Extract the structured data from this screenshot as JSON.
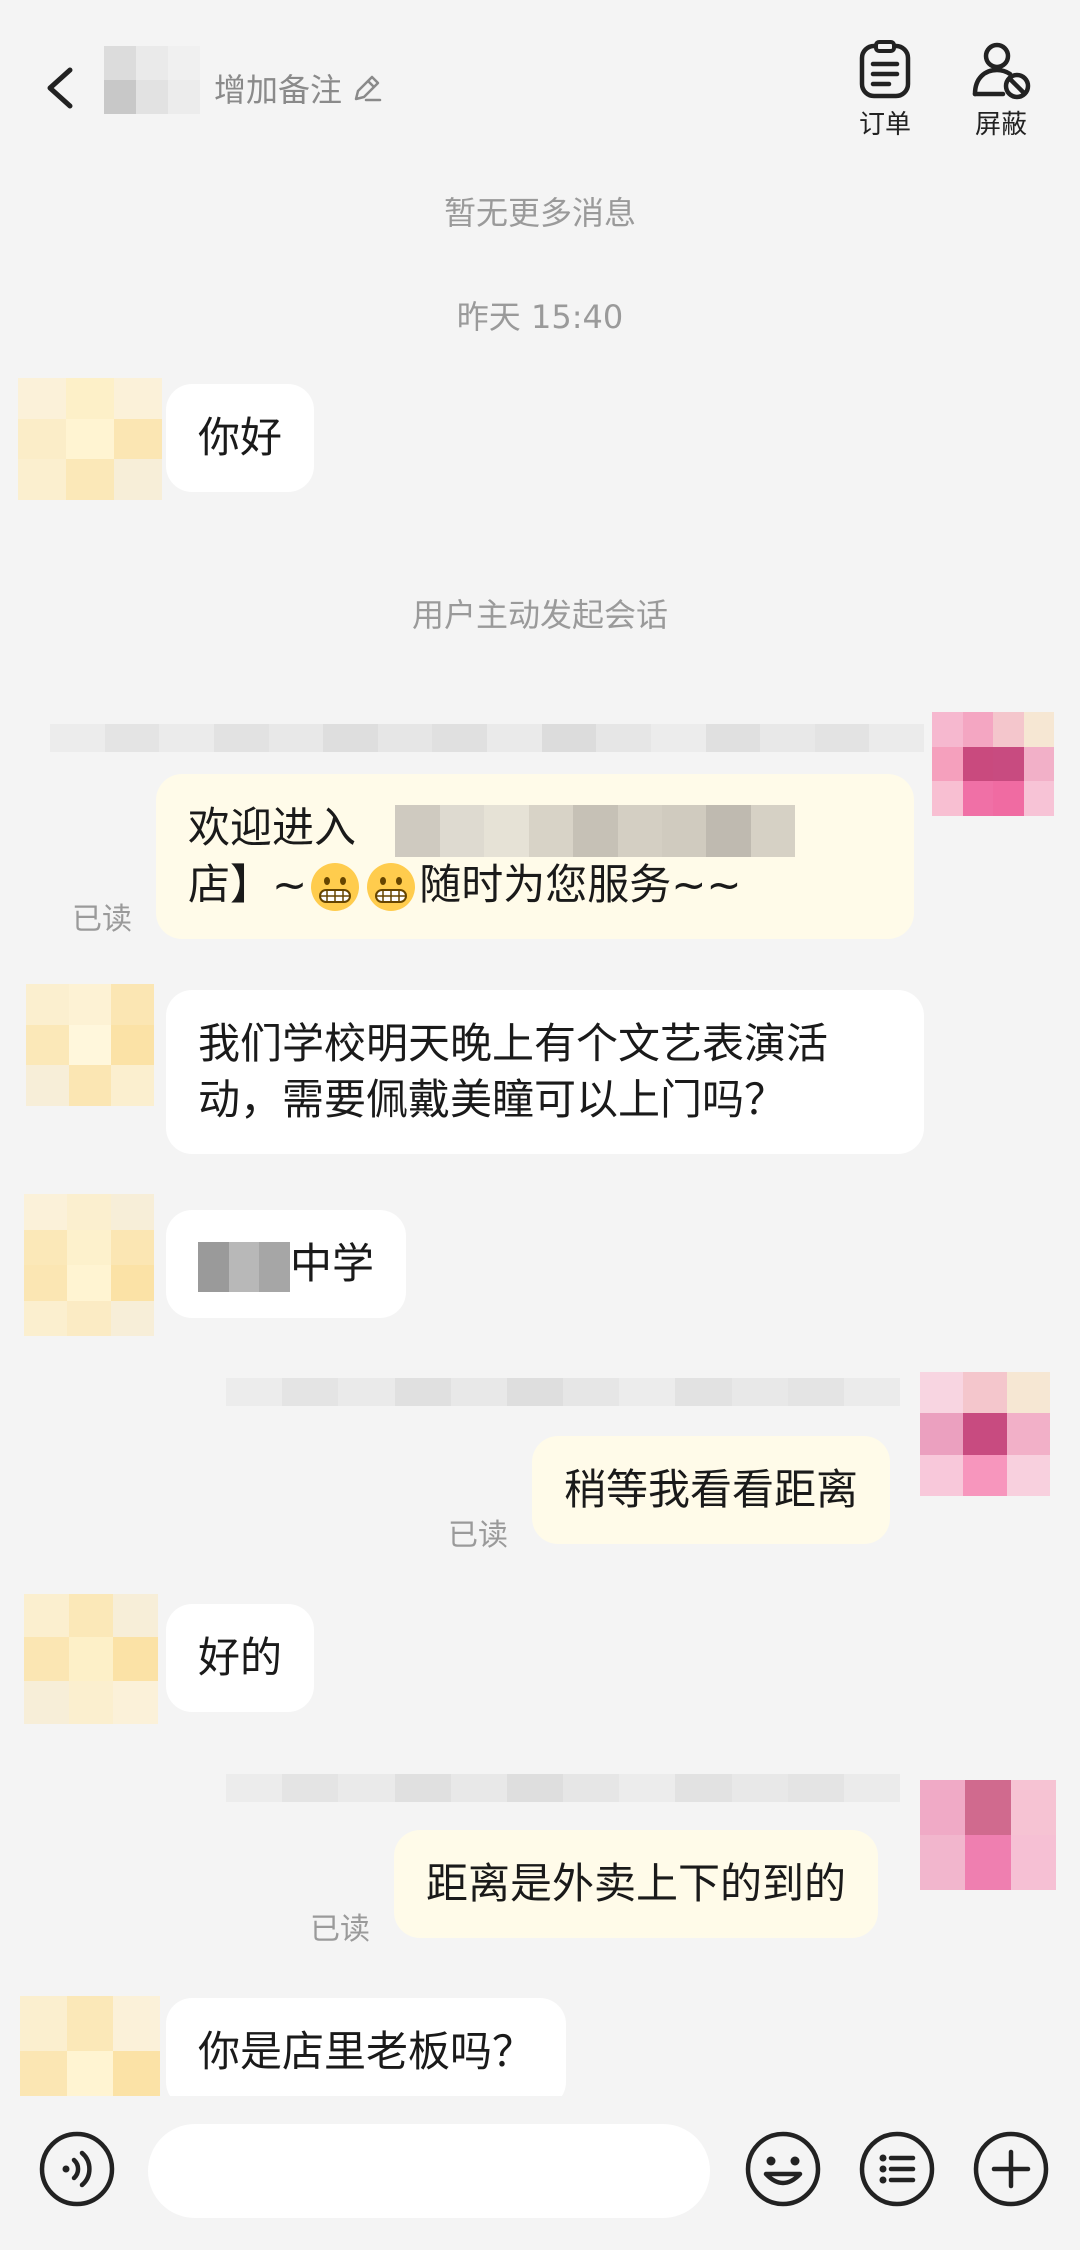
{
  "header": {
    "remark_label": "增加备注",
    "orders_label": "订单",
    "block_label": "屏蔽"
  },
  "system": {
    "no_more": "暂无更多消息",
    "timestamp": "昨天 15:40",
    "user_initiated": "用户主动发起会话"
  },
  "messages": [
    {
      "direction": "incoming",
      "text": "你好"
    },
    {
      "direction": "outgoing",
      "line1_prefix": "欢迎进入",
      "line2": "店】~",
      "line2_suffix": "随时为您服务~~",
      "read": "已读",
      "emoji": "grimacing-face"
    },
    {
      "direction": "incoming",
      "line1": "我们学校明天晚上有个文艺表演活",
      "line2": "动，需要佩戴美瞳可以上门吗？"
    },
    {
      "direction": "incoming",
      "text": "中学"
    },
    {
      "direction": "outgoing",
      "text": "稍等我看看距离",
      "read": "已读"
    },
    {
      "direction": "incoming",
      "text": "好的"
    },
    {
      "direction": "outgoing",
      "text": "距离是外卖上下的到的",
      "read": "已读"
    },
    {
      "direction": "incoming",
      "text": "你是店里老板吗？"
    }
  ],
  "input": {
    "placeholder": ""
  },
  "icons": {
    "back": "chevron-left-icon",
    "orders": "clipboard-icon",
    "block": "user-block-icon",
    "voice": "voice-icon",
    "emoji": "smiley-icon",
    "quick_reply": "list-icon",
    "more": "plus-icon"
  },
  "colors": {
    "background": "#f4f4f4",
    "incoming_bubble": "#ffffff",
    "outgoing_bubble": "#fffbe9",
    "muted_text": "#9a9a9a"
  }
}
